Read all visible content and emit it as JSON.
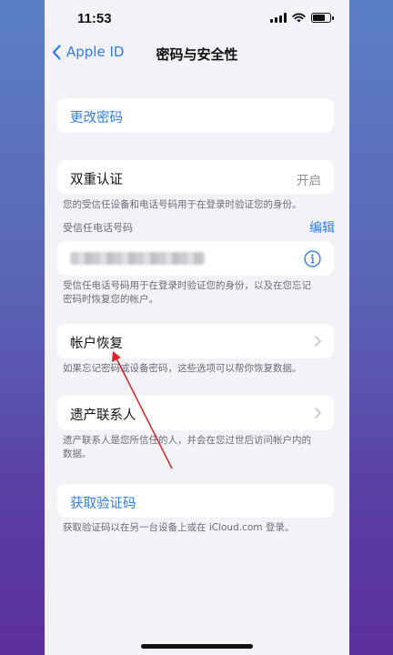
{
  "status_bar": {
    "time": "11:53",
    "signal_icon": "cellular-signal-icon",
    "wifi_icon": "wifi-icon",
    "battery_icon": "battery-icon",
    "battery_level": 0.7
  },
  "nav": {
    "back_label": "Apple ID",
    "title": "密码与安全性"
  },
  "change_password": {
    "label": "更改密码"
  },
  "two_factor": {
    "label": "双重认证",
    "value": "开启",
    "note": "您的受信任设备和电话号码用于在登录时验证您的身份。"
  },
  "trusted_numbers": {
    "header": "受信任电话号码",
    "edit_label": "编辑",
    "info_icon": "info-icon",
    "note_line1": "受信任电话号码用于在登录时验证您的身份，以及在您忘记",
    "note_line2": "密码时恢复您的帐户。"
  },
  "account_recovery": {
    "label": "帐户恢复",
    "note": "如果忘记密码或设备密码，这些选项可以帮你恢复数据。"
  },
  "legacy_contact": {
    "label": "遗产联系人",
    "note_line1": "遗产联系人是您所信任的人，并会在您过世后访问帐户内的",
    "note_line2": "数据。"
  },
  "verification_code": {
    "label": "获取验证码",
    "note": "获取验证码以在另一台设备上或在 iCloud.com 登录。"
  },
  "colors": {
    "accent": "#2f7cf6",
    "annotation_arrow": "#d8242a"
  }
}
